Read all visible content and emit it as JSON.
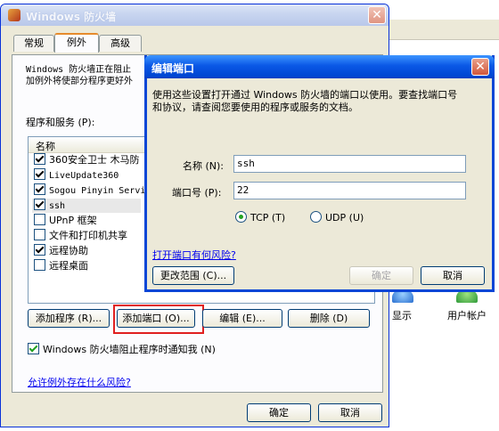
{
  "background": {
    "display_label": "显示",
    "user_accounts_label": "用户帐户"
  },
  "firewall_window": {
    "title": "Windows 防火墙",
    "tabs": [
      "常规",
      "例外",
      "高级"
    ],
    "description": "Windows 防火墙正在阻止除下列选定程序和服务之外的传入网络连接。添加例外将使部分程序更好地工作，但可能增加安全风险。",
    "desc_line1": "Windows 防火墙正在阻止",
    "desc_line2": "加例外将使部分程序更好外",
    "programs_label": "程序和服务 (P):",
    "column_name": "名称",
    "items": [
      {
        "label": "360安全卫士 木马防",
        "checked": true
      },
      {
        "label": "LiveUpdate360",
        "checked": true
      },
      {
        "label": "Sogou Pinyin Servi",
        "checked": true
      },
      {
        "label": "ssh",
        "checked": true
      },
      {
        "label": "UPnP 框架",
        "checked": false
      },
      {
        "label": "文件和打印机共享",
        "checked": false
      },
      {
        "label": "远程协助",
        "checked": true
      },
      {
        "label": "远程桌面",
        "checked": false
      }
    ],
    "add_program": "添加程序 (R)...",
    "add_port": "添加端口 (O)...",
    "edit": "编辑 (E)...",
    "delete": "删除 (D)",
    "notify_label": "Windows 防火墙阻止程序时通知我 (N)",
    "notify_checked": true,
    "risk_link": "允许例外存在什么风险?",
    "ok": "确定",
    "cancel": "取消"
  },
  "edit_port_dialog": {
    "title": "编辑端口",
    "description_line1": "使用这些设置打开通过 Windows 防火墙的端口以使用。要查找端口号",
    "description_line2": "和协议，请查阅您要使用的程序或服务的文档。",
    "name_label": "名称 (N):",
    "name_value": "ssh",
    "port_label": "端口号 (P):",
    "port_value": "22",
    "tcp_label": "TCP (T)",
    "udp_label": "UDP (U)",
    "protocol_selected": "TCP",
    "risk_link": "打开端口有何风险?",
    "change_scope": "更改范围 (C)...",
    "ok": "确定",
    "cancel": "取消"
  }
}
